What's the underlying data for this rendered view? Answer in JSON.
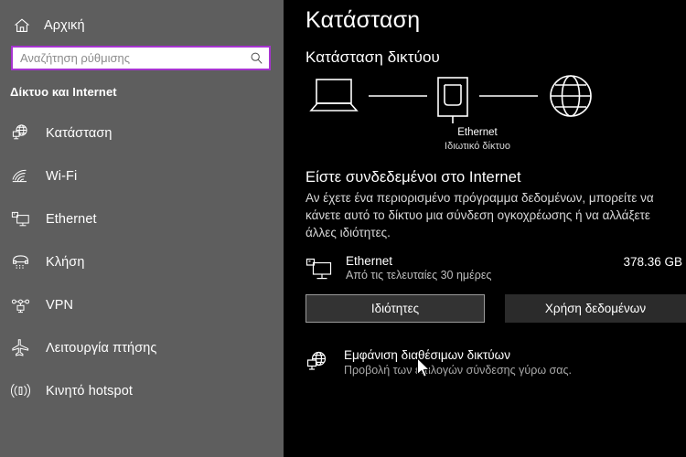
{
  "theme": {
    "sidebar_bg": "#5e5e5e",
    "main_bg": "#000000",
    "accent": "#a734d0",
    "button_bg": "#2b2b2b",
    "text_primary": "#ffffff",
    "text_secondary": "#bdbdbd"
  },
  "sidebar": {
    "home": {
      "label": "Αρχική",
      "icon": "home-icon"
    },
    "search": {
      "value": "",
      "placeholder": "Αναζήτηση ρύθμισης",
      "icon": "search-icon"
    },
    "category": "Δίκτυο και Internet",
    "items": [
      {
        "label": "Κατάσταση",
        "icon": "status-globe-icon"
      },
      {
        "label": "Wi-Fi",
        "icon": "wifi-icon"
      },
      {
        "label": "Ethernet",
        "icon": "ethernet-icon"
      },
      {
        "label": "Κλήση",
        "icon": "dialup-phone-icon"
      },
      {
        "label": "VPN",
        "icon": "vpn-icon"
      },
      {
        "label": "Λειτουργία πτήσης",
        "icon": "airplane-icon"
      },
      {
        "label": "Κινητό hotspot",
        "icon": "mobile-hotspot-icon"
      }
    ]
  },
  "main": {
    "page_title": "Κατάσταση",
    "section_heading": "Κατάσταση δικτύου",
    "diagram": {
      "device_icon": "laptop-icon",
      "network_icon": "ethernet-port-icon",
      "internet_icon": "globe-icon",
      "network_name": "Ethernet",
      "network_type": "Ιδιωτικό δίκτυο"
    },
    "connection": {
      "heading": "Είστε συνδεδεμένοι στο Internet",
      "description": "Αν έχετε ένα περιορισμένο πρόγραμμα δεδομένων, μπορείτε να κάνετε αυτό το δίκτυο μια σύνδεση ογκοχρέωσης ή να αλλάξετε άλλες ιδιότητες."
    },
    "adapter": {
      "icon": "ethernet-adapter-icon",
      "name": "Ethernet",
      "subtitle": "Από τις τελευταίες 30 ημέρες",
      "usage": "378.36 GB"
    },
    "buttons": {
      "properties": "Ιδιότητες",
      "data_usage": "Χρήση δεδομένων"
    },
    "show_networks": {
      "icon": "available-networks-icon",
      "title": "Εμφάνιση διαθέσιμων δικτύων",
      "subtitle": "Προβολή των επιλογών σύνδεσης γύρω σας."
    }
  }
}
